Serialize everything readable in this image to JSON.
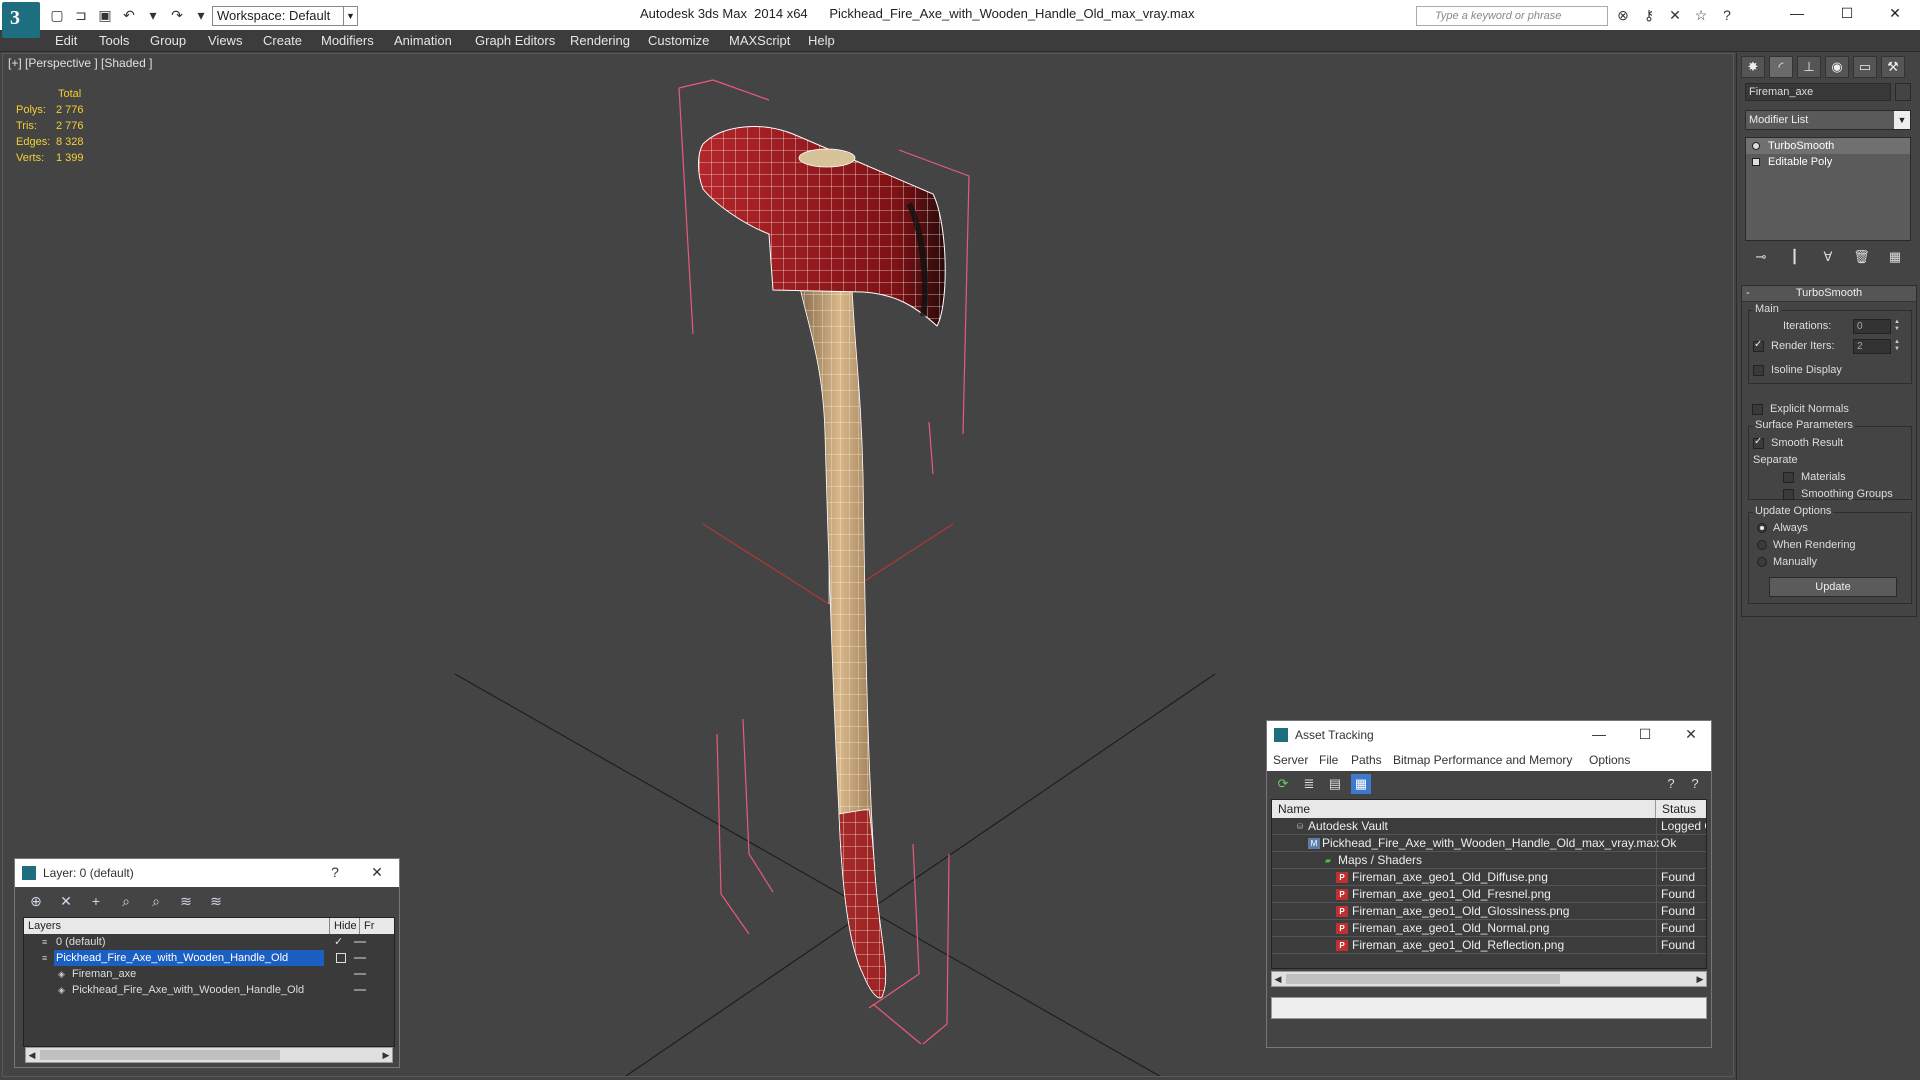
{
  "app": {
    "logo_letter": "3",
    "workspace": "Workspace: Default",
    "window_title": "Autodesk 3ds Max  2014 x64      Pickhead_Fire_Axe_with_Wooden_Handle_Old_max_vray.max",
    "search_placeholder": "Type a keyword or phrase"
  },
  "menu": [
    "Edit",
    "Tools",
    "Group",
    "Views",
    "Create",
    "Modifiers",
    "Animation",
    "Graph Editors",
    "Rendering",
    "Customize",
    "MAXScript",
    "Help"
  ],
  "viewport": {
    "label": "[+] [Perspective ] [Shaded ]",
    "stats": {
      "header": "Total",
      "rows": [
        {
          "key": "Polys:",
          "value": "2 776"
        },
        {
          "key": "Tris:",
          "value": "2 776"
        },
        {
          "key": "Edges:",
          "value": "8 328"
        },
        {
          "key": "Verts:",
          "value": "1 399"
        }
      ]
    }
  },
  "command_panel": {
    "object_name": "Fireman_axe",
    "modifier_list": "Modifier List",
    "stack": [
      "TurboSmooth",
      "Editable Poly"
    ],
    "rollout": {
      "title": "TurboSmooth",
      "main_group": "Main",
      "iterations_label": "Iterations:",
      "iterations_value": "0",
      "render_iters_label": "Render Iters:",
      "render_iters_value": "2",
      "render_iters_checked": true,
      "isoline_label": "Isoline Display",
      "explicit_normals_label": "Explicit Normals",
      "surface_group": "Surface Parameters",
      "smooth_result_label": "Smooth Result",
      "separate_label": "Separate",
      "materials_label": "Materials",
      "smoothing_groups_label": "Smoothing Groups",
      "update_group": "Update Options",
      "always_label": "Always",
      "when_rendering_label": "When Rendering",
      "manually_label": "Manually",
      "update_button": "Update"
    }
  },
  "layer_window": {
    "title": "Layer: 0 (default)",
    "help": "?",
    "columns": [
      "Layers",
      "Hide",
      "Fr"
    ],
    "rows": [
      {
        "name": "0 (default)",
        "indent": 1,
        "selected": false,
        "check": true
      },
      {
        "name": "Pickhead_Fire_Axe_with_Wooden_Handle_Old",
        "indent": 1,
        "selected": true,
        "check": false
      },
      {
        "name": "Fireman_axe",
        "indent": 2,
        "selected": false,
        "check": false
      },
      {
        "name": "Pickhead_Fire_Axe_with_Wooden_Handle_Old",
        "indent": 2,
        "selected": false,
        "check": false
      }
    ]
  },
  "asset_tracking": {
    "title": "Asset Tracking",
    "menu": [
      "Server",
      "File",
      "Paths",
      "Bitmap Performance and Memory",
      "Options"
    ],
    "columns": [
      "Name",
      "Status"
    ],
    "rows": [
      {
        "name": "Autodesk Vault",
        "status": "Logged Ou",
        "indent": 1,
        "icon": "vault-icon"
      },
      {
        "name": "Pickhead_Fire_Axe_with_Wooden_Handle_Old_max_vray.max",
        "status": "Ok",
        "indent": 2,
        "icon": "max-file-icon"
      },
      {
        "name": "Maps / Shaders",
        "status": "",
        "indent": 3,
        "icon": "maps-icon"
      },
      {
        "name": "Fireman_axe_geo1_Old_Diffuse.png",
        "status": "Found",
        "indent": 4,
        "icon": "png-icon"
      },
      {
        "name": "Fireman_axe_geo1_Old_Fresnel.png",
        "status": "Found",
        "indent": 4,
        "icon": "png-icon"
      },
      {
        "name": "Fireman_axe_geo1_Old_Glossiness.png",
        "status": "Found",
        "indent": 4,
        "icon": "png-icon"
      },
      {
        "name": "Fireman_axe_geo1_Old_Normal.png",
        "status": "Found",
        "indent": 4,
        "icon": "png-icon"
      },
      {
        "name": "Fireman_axe_geo1_Old_Reflection.png",
        "status": "Found",
        "indent": 4,
        "icon": "png-icon"
      }
    ]
  },
  "colors": {
    "stats_text": "#f2d033",
    "selection": "#1c5fc2",
    "bbox": "#e85a7a",
    "axe_head": "#9e1b1f",
    "handle": "#c9a67a"
  }
}
